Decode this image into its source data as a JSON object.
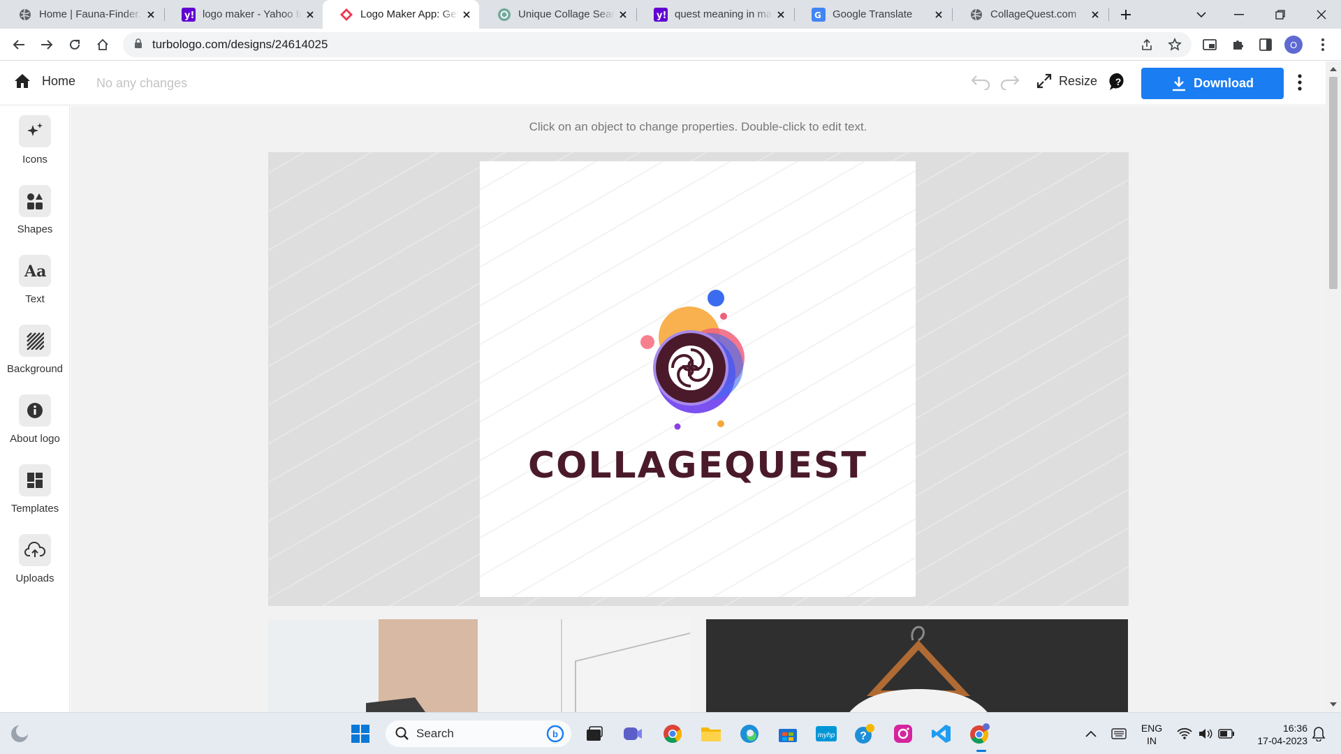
{
  "browser": {
    "tabs": [
      {
        "title": "Home | Fauna-Finder.",
        "icon": "globe-icon",
        "active": false
      },
      {
        "title": "logo maker - Yahoo In",
        "icon": "yahoo-icon",
        "active": false
      },
      {
        "title": "Logo Maker App: Get",
        "icon": "turbologo-icon",
        "active": true
      },
      {
        "title": "Unique Collage Search",
        "icon": "chatgpt-icon",
        "active": false
      },
      {
        "title": "quest meaning in mar",
        "icon": "yahoo-icon",
        "active": false
      },
      {
        "title": "Google Translate",
        "icon": "google-translate-icon",
        "active": false
      },
      {
        "title": "CollageQuest.com",
        "icon": "globe-icon",
        "active": false
      }
    ],
    "url": "turbologo.com/designs/24614025",
    "profile_initial": "O"
  },
  "toolbar": {
    "home_label": "Home",
    "status": "No any changes",
    "resize_label": "Resize",
    "download_label": "Download"
  },
  "sidebar": {
    "items": [
      {
        "label": "Icons",
        "icon": "sparkle-icon"
      },
      {
        "label": "Shapes",
        "icon": "shapes-icon"
      },
      {
        "label": "Text",
        "icon": "text-icon"
      },
      {
        "label": "Background",
        "icon": "background-icon"
      },
      {
        "label": "About logo",
        "icon": "info-icon"
      },
      {
        "label": "Templates",
        "icon": "templates-icon"
      },
      {
        "label": "Uploads",
        "icon": "upload-icon"
      }
    ]
  },
  "editor": {
    "hint": "Click on an object to change properties. Double-click to edit text.",
    "brand_name": "COLLAGEQUEST",
    "colors": {
      "brand_text": "#4a1a2b",
      "download_button": "#1a7df2",
      "logo_orange": "#f7a83b",
      "logo_pink": "#f0607a",
      "logo_blue": "#3b6cf0",
      "logo_purple": "#8b3fe0"
    }
  },
  "taskbar": {
    "search_placeholder": "Search",
    "language": "ENG",
    "region": "IN",
    "time": "16:36",
    "date": "17-04-2023"
  }
}
